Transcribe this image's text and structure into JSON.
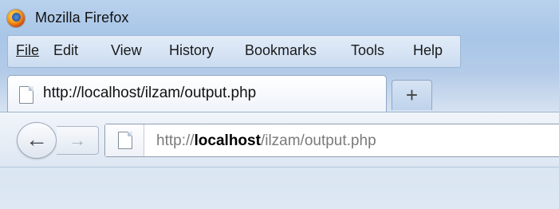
{
  "window": {
    "title": "Mozilla Firefox"
  },
  "menu": {
    "items": [
      {
        "label": "File"
      },
      {
        "label": "Edit"
      },
      {
        "label": "View"
      },
      {
        "label": "History"
      },
      {
        "label": "Bookmarks"
      },
      {
        "label": "Tools"
      },
      {
        "label": "Help"
      }
    ]
  },
  "tabs": [
    {
      "title": "http://localhost/ilzam/output.php"
    }
  ],
  "newtab": {
    "label": "+"
  },
  "nav": {
    "back_glyph": "←",
    "forward_glyph": "→"
  },
  "urlbar": {
    "scheme": "http://",
    "host": "localhost",
    "path": "/ilzam/output.php"
  },
  "icons": {
    "app": "firefox-logo",
    "page": "page-icon",
    "back": "back-arrow-icon",
    "forward": "forward-arrow-icon",
    "newtab": "plus-icon"
  }
}
